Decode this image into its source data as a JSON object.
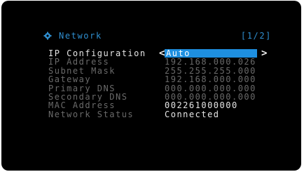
{
  "header": {
    "title": "Network",
    "page_indicator": "[1/2]",
    "gear_icon": "gear-icon"
  },
  "colors": {
    "accent": "#1e8fe0",
    "header_text": "#2f8fd0",
    "dim_text": "#6a6a6a",
    "bright_text": "#e6e6e6"
  },
  "rows": [
    {
      "label": "IP Configuration",
      "value": "Auto"
    },
    {
      "label": "IP Address",
      "value": "192.168.000.026"
    },
    {
      "label": "Subnet Mask",
      "value": "255.255.255.000"
    },
    {
      "label": "Gateway",
      "value": "192.168.000.000"
    },
    {
      "label": "Primary DNS",
      "value": "000.000.000.000"
    },
    {
      "label": "Secondary DNS",
      "value": "000.000.000.000"
    },
    {
      "label": "MAC Address",
      "value": "002261000000"
    },
    {
      "label": "Network Status",
      "value": "Connected"
    }
  ],
  "arrows": {
    "left": "<",
    "right": ">"
  }
}
